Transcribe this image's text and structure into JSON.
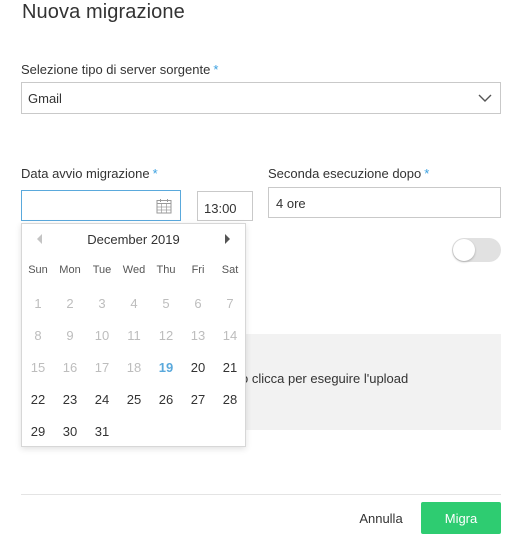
{
  "dialog": {
    "title": "Nuova migrazione"
  },
  "source": {
    "label": "Selezione tipo di server sorgente",
    "required_mark": "*",
    "value": "Gmail"
  },
  "start": {
    "label": "Data avvio migrazione",
    "required_mark": "*",
    "date_value": "",
    "time_value": "13:00"
  },
  "second_run": {
    "label": "Seconda esecuzione dopo",
    "required_mark": "*",
    "value": "4 ore"
  },
  "toggle": {
    "state": "off"
  },
  "upload": {
    "text": "o clicca per eseguire l'upload"
  },
  "footer": {
    "cancel_label": "Annulla",
    "submit_label": "Migra"
  },
  "calendar": {
    "month_label": "December 2019",
    "weekdays": [
      "Sun",
      "Mon",
      "Tue",
      "Wed",
      "Thu",
      "Fri",
      "Sat"
    ],
    "weeks": [
      [
        {
          "d": "1",
          "s": "muted"
        },
        {
          "d": "2",
          "s": "muted"
        },
        {
          "d": "3",
          "s": "muted"
        },
        {
          "d": "4",
          "s": "muted"
        },
        {
          "d": "5",
          "s": "muted"
        },
        {
          "d": "6",
          "s": "muted"
        },
        {
          "d": "7",
          "s": "muted"
        }
      ],
      [
        {
          "d": "8",
          "s": "muted"
        },
        {
          "d": "9",
          "s": "muted"
        },
        {
          "d": "10",
          "s": "muted"
        },
        {
          "d": "11",
          "s": "muted"
        },
        {
          "d": "12",
          "s": "muted"
        },
        {
          "d": "13",
          "s": "muted"
        },
        {
          "d": "14",
          "s": "muted"
        }
      ],
      [
        {
          "d": "15",
          "s": "muted"
        },
        {
          "d": "16",
          "s": "muted"
        },
        {
          "d": "17",
          "s": "muted"
        },
        {
          "d": "18",
          "s": "muted"
        },
        {
          "d": "19",
          "s": "today"
        },
        {
          "d": "20",
          "s": "active"
        },
        {
          "d": "21",
          "s": "active"
        }
      ],
      [
        {
          "d": "22",
          "s": "active"
        },
        {
          "d": "23",
          "s": "active"
        },
        {
          "d": "24",
          "s": "active"
        },
        {
          "d": "25",
          "s": "active"
        },
        {
          "d": "26",
          "s": "active"
        },
        {
          "d": "27",
          "s": "active"
        },
        {
          "d": "28",
          "s": "active"
        }
      ],
      [
        {
          "d": "29",
          "s": "active"
        },
        {
          "d": "30",
          "s": "active"
        },
        {
          "d": "31",
          "s": "active"
        }
      ]
    ]
  },
  "colors": {
    "accent": "#5aa9dc",
    "primary_button": "#2ecc71",
    "required_mark": "#3aa0e0"
  }
}
